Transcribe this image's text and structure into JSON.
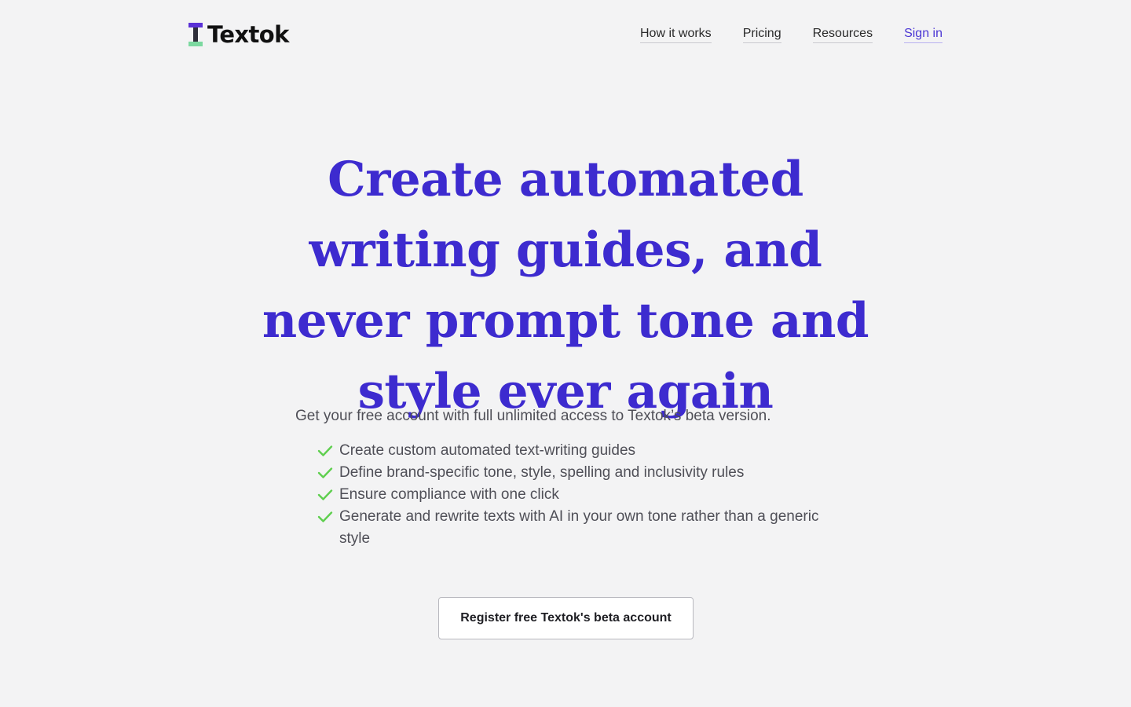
{
  "brand": {
    "name": "Textok",
    "logo_colors": {
      "top": "#5a31d6",
      "stem": "#2e2e3a",
      "base": "#7cd9a0"
    }
  },
  "nav": {
    "items": [
      {
        "label": "How it works"
      },
      {
        "label": "Pricing"
      },
      {
        "label": "Resources"
      },
      {
        "label": "Sign in"
      }
    ]
  },
  "hero": {
    "title": "Create automated writing guides, and never prompt tone and style ever again"
  },
  "intro": "Get your free account with full unlimited access to Textok’s beta version.",
  "features": [
    {
      "icon": "check-icon",
      "text": "Create custom automated text-writing guides"
    },
    {
      "icon": "check-icon",
      "text": "Define brand-specific tone, style, spelling and inclusivity rules"
    },
    {
      "icon": "check-icon",
      "text": "Ensure compliance with one click"
    },
    {
      "icon": "check-icon",
      "text": "Generate and rewrite texts with AI in your own tone rather than a generic style"
    }
  ],
  "cta": {
    "label": "Register free Textok's beta account"
  },
  "colors": {
    "background": "#f3f3f4",
    "accent": "#3d2bcf",
    "check": "#5fcf4f"
  }
}
